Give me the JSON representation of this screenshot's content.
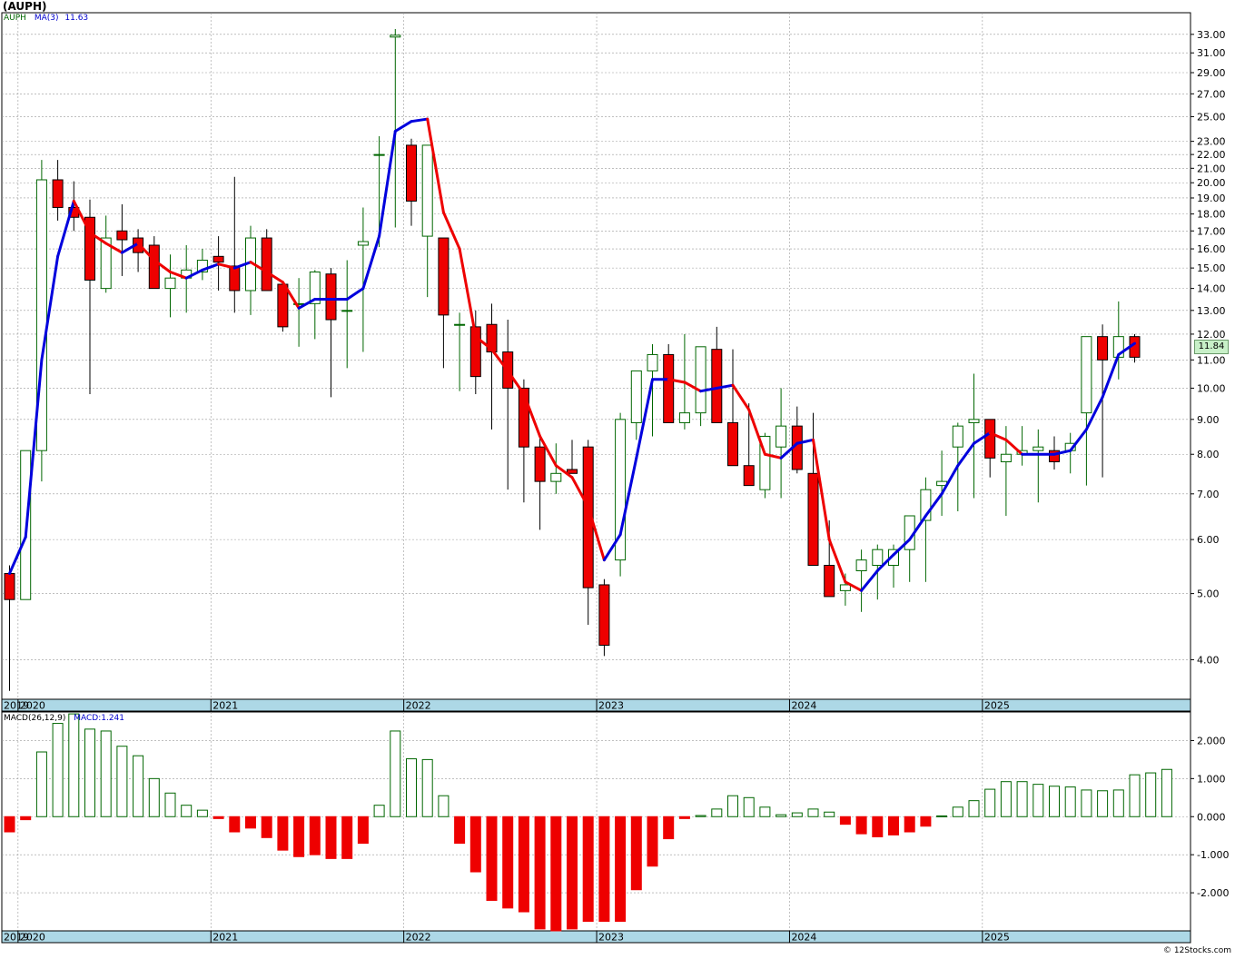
{
  "title": "(AUPH)",
  "legend": {
    "symbol": "AUPH",
    "ma_label": "MA(3)",
    "ma_value": "11.63"
  },
  "macd_legend": {
    "label": "MACD(26,12,9)",
    "value_label": "MACD:1.241"
  },
  "last_price": "11.84",
  "credit": "© 12Stocks.com",
  "colors": {
    "up": "#ffffff",
    "up_stroke": "#006600",
    "down": "#ee0000",
    "ma_up": "#0000dd",
    "ma_down": "#ee0000",
    "axis_band": "#add8e6",
    "grid": "#999999"
  },
  "chart_data": [
    {
      "type": "candlestick",
      "interval": "monthly",
      "scale": "log",
      "ylim": [
        3.5,
        35.5
      ],
      "yticks": [
        "4.00",
        "5.00",
        "6.00",
        "7.00",
        "8.00",
        "9.00",
        "10.00",
        "11.00",
        "12.00",
        "13.00",
        "14.00",
        "15.00",
        "16.00",
        "17.00",
        "18.00",
        "19.00",
        "20.00",
        "21.00",
        "22.00",
        "23.00",
        "25.00",
        "27.00",
        "29.00",
        "31.00",
        "33.00"
      ],
      "xlabels": [
        "2019",
        "2020",
        "2021",
        "2022",
        "2023",
        "2024",
        "2025"
      ],
      "months": [
        "2019-12",
        "2020-01",
        "2020-02",
        "2020-03",
        "2020-04",
        "2020-05",
        "2020-06",
        "2020-07",
        "2020-08",
        "2020-09",
        "2020-10",
        "2020-11",
        "2020-12",
        "2021-01",
        "2021-02",
        "2021-03",
        "2021-04",
        "2021-05",
        "2021-06",
        "2021-07",
        "2021-08",
        "2021-09",
        "2021-10",
        "2021-11",
        "2021-12",
        "2022-01",
        "2022-02",
        "2022-03",
        "2022-04",
        "2022-05",
        "2022-06",
        "2022-07",
        "2022-08",
        "2022-09",
        "2022-10",
        "2022-11",
        "2022-12",
        "2023-01",
        "2023-02",
        "2023-03",
        "2023-04",
        "2023-05",
        "2023-06",
        "2023-07",
        "2023-08",
        "2023-09",
        "2023-10",
        "2023-11",
        "2023-12",
        "2024-01",
        "2024-02",
        "2024-03",
        "2024-04",
        "2024-05",
        "2024-06",
        "2024-07",
        "2024-08",
        "2024-09",
        "2024-10",
        "2024-11",
        "2024-12",
        "2025-01",
        "2025-02",
        "2025-03",
        "2025-04",
        "2025-05",
        "2025-06",
        "2025-07",
        "2025-08",
        "2025-09",
        "2025-10"
      ],
      "open": [
        5.35,
        4.9,
        8.1,
        20.2,
        18.4,
        17.8,
        14.0,
        17.0,
        16.6,
        16.2,
        14.0,
        14.5,
        14.8,
        15.6,
        15.1,
        13.9,
        16.6,
        14.2,
        13.3,
        13.3,
        14.7,
        13.0,
        16.2,
        22.0,
        32.7,
        22.7,
        16.7,
        16.6,
        12.4,
        12.3,
        12.4,
        11.3,
        10.0,
        8.2,
        7.3,
        7.6,
        8.2,
        5.15,
        5.6,
        8.9,
        10.6,
        11.2,
        8.9,
        9.2,
        11.4,
        8.9,
        7.7,
        7.1,
        8.2,
        8.8,
        7.5,
        5.5,
        5.05,
        5.4,
        5.5,
        5.5,
        5.8,
        6.4,
        7.2,
        8.2,
        8.9,
        9.0,
        7.8,
        8.0,
        8.1,
        8.1,
        8.1,
        9.2,
        11.9,
        11.1,
        11.9
      ],
      "high": [
        5.5,
        8.1,
        21.6,
        21.6,
        20.1,
        18.9,
        17.9,
        18.6,
        17.1,
        16.7,
        15.7,
        16.2,
        16.0,
        16.7,
        20.4,
        17.3,
        17.1,
        14.1,
        14.5,
        14.9,
        15.0,
        15.4,
        18.4,
        23.4,
        33.6,
        23.2,
        20.3,
        14.0,
        12.9,
        13.0,
        13.3,
        12.6,
        10.3,
        8.5,
        8.3,
        8.4,
        8.4,
        5.25,
        9.2,
        10.0,
        11.6,
        11.6,
        12.0,
        10.4,
        12.3,
        11.4,
        9.5,
        8.6,
        10.0,
        9.4,
        9.2,
        6.4,
        5.35,
        5.8,
        5.9,
        5.9,
        6.2,
        7.4,
        8.1,
        8.9,
        10.5,
        9.0,
        8.8,
        8.8,
        8.7,
        8.5,
        8.6,
        9.6,
        12.4,
        13.4,
        12.0
      ],
      "low": [
        3.6,
        4.9,
        7.3,
        17.6,
        17.0,
        9.8,
        13.8,
        14.6,
        14.8,
        15.1,
        12.7,
        12.9,
        14.4,
        13.9,
        12.9,
        12.8,
        14.5,
        12.1,
        11.5,
        11.8,
        9.7,
        10.7,
        11.3,
        16.1,
        17.2,
        17.3,
        13.6,
        10.7,
        9.9,
        9.8,
        8.7,
        7.1,
        6.8,
        6.2,
        7.0,
        7.6,
        4.5,
        4.05,
        5.3,
        8.4,
        8.5,
        10.0,
        8.7,
        8.8,
        9.6,
        8.7,
        7.4,
        6.9,
        6.9,
        7.5,
        7.3,
        5.3,
        4.8,
        4.7,
        4.9,
        5.1,
        5.2,
        5.2,
        6.5,
        6.6,
        6.9,
        7.4,
        6.5,
        7.7,
        6.8,
        7.6,
        7.5,
        7.2,
        7.4,
        10.3,
        10.9
      ],
      "close": [
        4.9,
        8.1,
        20.2,
        18.4,
        17.8,
        14.4,
        16.6,
        16.5,
        15.8,
        14.0,
        14.5,
        14.9,
        15.4,
        15.3,
        13.9,
        16.6,
        13.9,
        12.3,
        13.3,
        14.8,
        12.6,
        13.0,
        16.4,
        22.0,
        32.9,
        18.8,
        22.7,
        12.8,
        12.4,
        10.4,
        11.3,
        10.0,
        8.2,
        7.3,
        7.5,
        7.5,
        5.1,
        4.2,
        9.0,
        10.6,
        11.2,
        8.9,
        9.2,
        11.5,
        8.9,
        7.7,
        7.2,
        8.5,
        8.8,
        7.6,
        5.5,
        4.95,
        5.15,
        5.6,
        5.8,
        5.8,
        6.5,
        7.1,
        7.3,
        8.8,
        9.0,
        7.9,
        8.0,
        8.1,
        8.2,
        7.8,
        8.3,
        11.9,
        11.0,
        11.9,
        11.1
      ],
      "ma3": [
        5.35,
        6.05,
        11.0,
        15.6,
        18.8,
        16.9,
        16.3,
        15.8,
        16.3,
        15.4,
        14.8,
        14.5,
        14.9,
        15.2,
        15.0,
        15.3,
        14.8,
        14.3,
        13.1,
        13.5,
        13.5,
        13.5,
        14.0,
        16.7,
        23.8,
        24.6,
        24.8,
        18.1,
        16.0,
        11.9,
        11.4,
        10.6,
        9.8,
        8.5,
        7.7,
        7.4,
        6.7,
        5.6,
        6.1,
        7.9,
        10.3,
        10.3,
        10.2,
        9.9,
        10.0,
        10.1,
        9.3,
        8.0,
        7.9,
        8.3,
        8.4,
        6.0,
        5.2,
        5.05,
        5.4,
        5.7,
        6.0,
        6.5,
        7.0,
        7.7,
        8.3,
        8.6,
        8.4,
        8.0,
        8.0,
        8.0,
        8.1,
        8.7,
        9.7,
        11.2,
        11.63
      ]
    },
    {
      "type": "bar",
      "name": "MACD(26,12,9)",
      "ylim": [
        -3.0,
        2.75
      ],
      "yticks": [
        "2.000",
        "1.000",
        "0.000",
        "-1.000",
        "-2.000"
      ],
      "values": [
        -0.4,
        -0.08,
        1.7,
        2.45,
        2.7,
        2.3,
        2.25,
        1.85,
        1.6,
        1.0,
        0.62,
        0.3,
        0.17,
        -0.05,
        -0.4,
        -0.3,
        -0.55,
        -0.88,
        -1.05,
        -1.0,
        -1.1,
        -1.1,
        -0.7,
        0.3,
        2.25,
        1.52,
        1.5,
        0.55,
        -0.7,
        -1.45,
        -2.2,
        -2.4,
        -2.5,
        -2.95,
        -3.0,
        -2.95,
        -2.75,
        -2.75,
        -2.75,
        -1.92,
        -1.3,
        -0.58,
        -0.05,
        0.03,
        0.2,
        0.55,
        0.5,
        0.25,
        0.05,
        0.1,
        0.2,
        0.12,
        -0.2,
        -0.45,
        -0.53,
        -0.48,
        -0.4,
        -0.25,
        0.02,
        0.25,
        0.42,
        0.72,
        0.92,
        0.92,
        0.85,
        0.8,
        0.78,
        0.7,
        0.68,
        0.7,
        1.1,
        1.15,
        1.241
      ]
    }
  ]
}
